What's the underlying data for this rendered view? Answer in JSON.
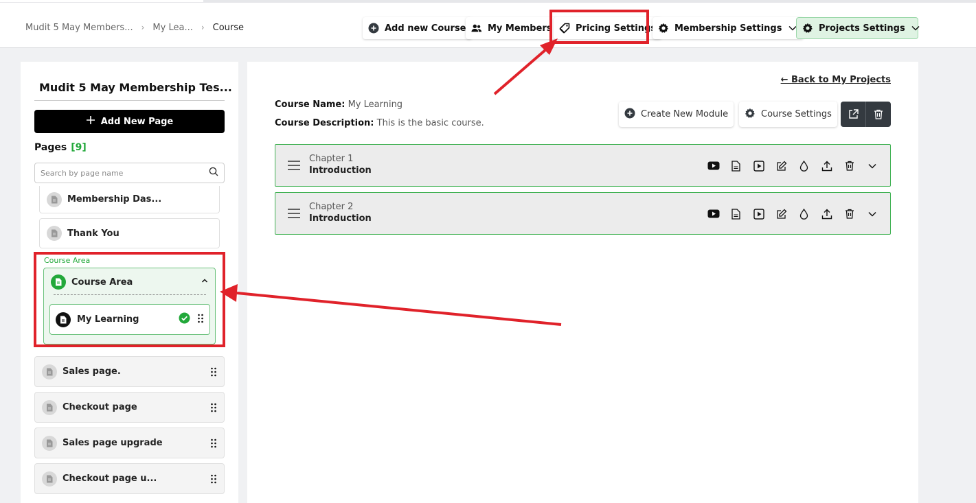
{
  "header": {
    "breadcrumb": [
      "Mudit 5 May Members...",
      "My Lea...",
      "Course"
    ],
    "buttons": {
      "add_course": "Add new Course",
      "my_members": "My Members",
      "pricing": "Pricing Settings",
      "membership": "Membership Settings",
      "projects": "Projects Settings"
    }
  },
  "sidebar": {
    "project_title": "Mudit 5 May Membership Tes...",
    "add_page": "Add New Page",
    "pages_label": "Pages",
    "pages_count": "[9]",
    "search_placeholder": "Search by page name",
    "pages_top": [
      "Membership Das...",
      "Thank You"
    ],
    "course_area_label": "Course Area",
    "course_area_title": "Course Area",
    "course_item": "My Learning",
    "pages_bottom": [
      "Sales page.",
      "Checkout page",
      "Sales page upgrade",
      "Checkout page u..."
    ]
  },
  "main": {
    "back_link": "← Back to My Projects",
    "course_name_label": "Course Name:",
    "course_name": "My Learning",
    "course_desc_label": "Course Description:",
    "course_desc": "This is the basic course.",
    "create_module": "Create New Module",
    "course_settings": "Course Settings",
    "chapters": [
      {
        "label": "Chapter 1",
        "name": "Introduction"
      },
      {
        "label": "Chapter 2",
        "name": "Introduction"
      }
    ]
  },
  "colors": {
    "accent_green": "#22a83a",
    "highlight_red": "#e0222a",
    "dark_button": "#343a40"
  }
}
